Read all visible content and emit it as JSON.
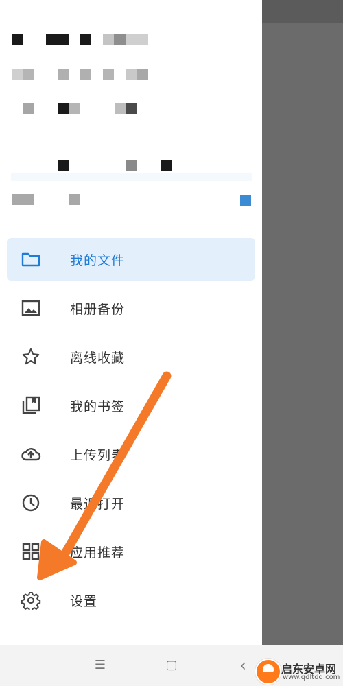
{
  "app": {
    "menu": [
      {
        "label": "我的文件",
        "icon": "folder-icon",
        "active": true
      },
      {
        "label": "相册备份",
        "icon": "image-icon",
        "active": false
      },
      {
        "label": "离线收藏",
        "icon": "star-icon",
        "active": false
      },
      {
        "label": "我的书签",
        "icon": "bookmark-icon",
        "active": false
      },
      {
        "label": "上传列表",
        "icon": "cloud-upload-icon",
        "active": false
      },
      {
        "label": "最近打开",
        "icon": "clock-icon",
        "active": false
      },
      {
        "label": "应用推荐",
        "icon": "apps-grid-icon",
        "active": false
      },
      {
        "label": "设置",
        "icon": "gear-icon",
        "active": false
      }
    ]
  },
  "system_nav": {
    "menu_glyph": "☰",
    "home_glyph": "▢",
    "back_glyph": "‹"
  },
  "watermark": {
    "title": "启东安卓网",
    "url": "www.qdltdq.com"
  },
  "colors": {
    "accent": "#1f7bd8",
    "active_bg": "#e3f0fb",
    "arrow": "#f47a2a",
    "scrim": "#6b6b6b"
  }
}
